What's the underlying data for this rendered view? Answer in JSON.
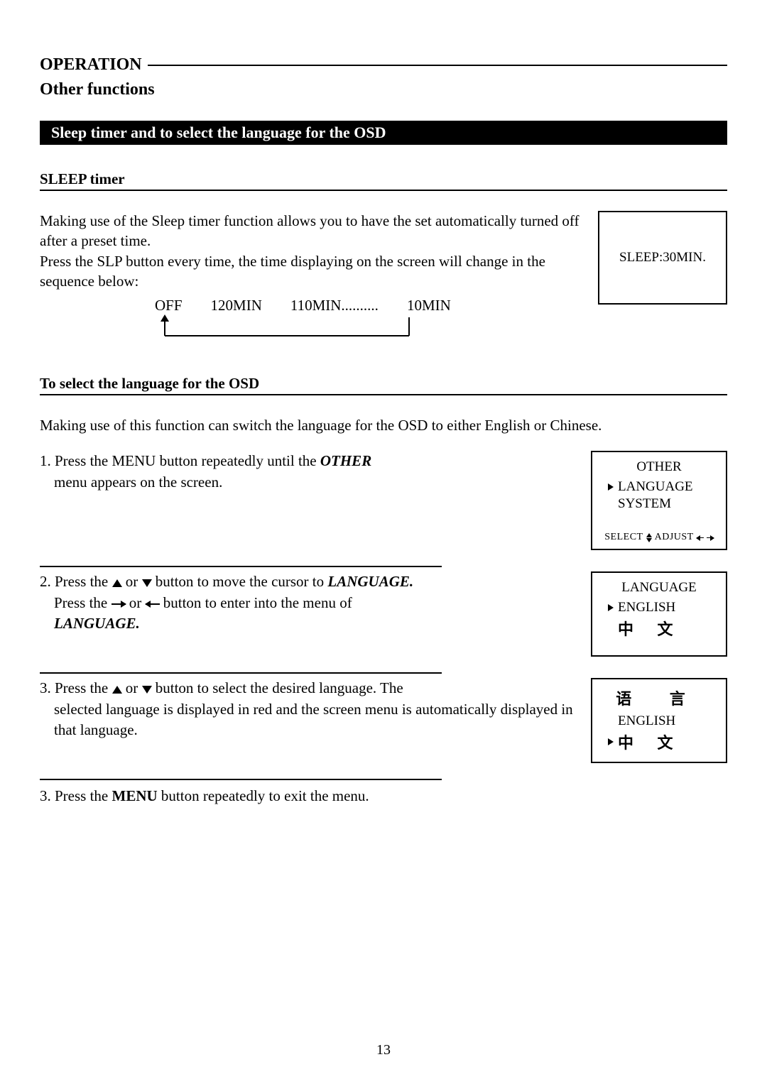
{
  "header": {
    "section": "OPERATION",
    "subsection": "Other functions"
  },
  "banner": "Sleep timer and to select the language for the OSD",
  "sleep": {
    "heading": "SLEEP timer",
    "para1": "Making use of the Sleep timer function allows you to have the set automatically turned off after a preset time.",
    "para2": "Press the SLP button every time, the time displaying on the screen will change in the sequence below:",
    "seq": {
      "off": "OFF",
      "s1": "120MIN",
      "s2": "110MIN..........",
      "s3": "10MIN"
    },
    "box": "SLEEP:30MIN."
  },
  "lang": {
    "heading": "To select the language for the OSD",
    "intro": "Making use of this function can switch the language for the OSD to either English or Chinese.",
    "step1a": "1. Press the MENU button repeatedly until the ",
    "step1b": "OTHER",
    "step1c": "menu appears on the screen.",
    "osd1": {
      "title": "OTHER",
      "item1": "LANGUAGE",
      "item2": "SYSTEM",
      "footL": "SELECT",
      "footR": "ADJUST"
    },
    "step2a": "2. Press the ",
    "step2b": " or ",
    "step2c": " button to move the cursor  to ",
    "step2d": "LANGUAGE.",
    "step2e": "Press the ",
    "step2f": " or ",
    "step2g": " button to enter into the menu of",
    "step2h": "LANGUAGE",
    "osd2": {
      "title": "LANGUAGE",
      "item1": "ENGLISH",
      "item2": "中 文"
    },
    "step3a": "3. Press the ",
    "step3b": " or ",
    "step3c": " button to select the desired language. The",
    "step3d": "selected language is displayed in red and the screen menu is automatically displayed in that language.",
    "osd3": {
      "title": "语 言",
      "item1": "ENGLISH",
      "item2": "中 文"
    },
    "step4a": "3. Press the ",
    "step4b": "MENU",
    "step4c": " button repeatedly to exit the menu."
  },
  "pagenum": "13"
}
